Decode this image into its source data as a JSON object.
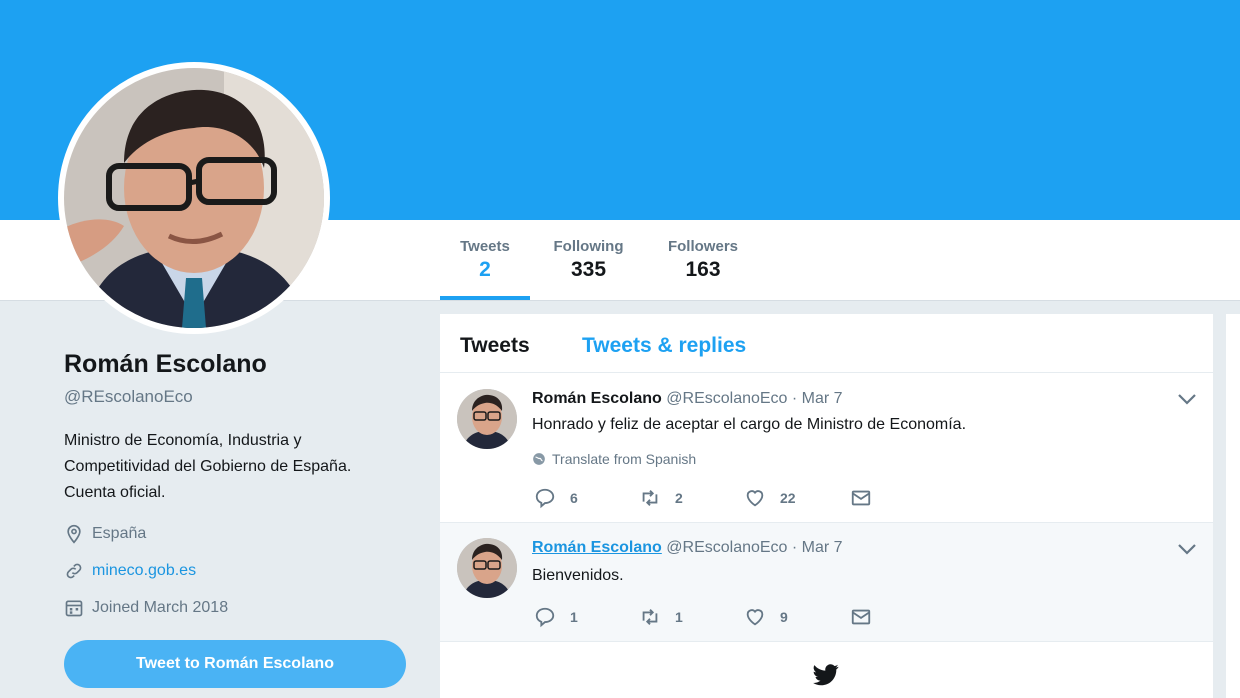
{
  "profile": {
    "name": "Román Escolano",
    "handle": "@REscolanoEco",
    "bio": "Ministro de Economía, Industria y Competitividad del Gobierno de España. Cuenta oficial.",
    "location": "España",
    "website": "mineco.gob.es",
    "joined": "Joined March 2018",
    "tweet_to_label": "Tweet to Román Escolano"
  },
  "stats": [
    {
      "label": "Tweets",
      "value": "2",
      "active": true
    },
    {
      "label": "Following",
      "value": "335",
      "active": false
    },
    {
      "label": "Followers",
      "value": "163",
      "active": false
    }
  ],
  "timeline_tabs": {
    "tweets": "Tweets",
    "tweets_replies": "Tweets & replies"
  },
  "tweets": [
    {
      "author": "Román Escolano",
      "handle": "@REscolanoEco",
      "date": "· Mar 7",
      "text": "Honrado y feliz de aceptar el cargo de Ministro de Economía.",
      "translate": "Translate from Spanish",
      "replies": "6",
      "retweets": "2",
      "likes": "22"
    },
    {
      "author": "Román Escolano",
      "handle": "@REscolanoEco",
      "date": "· Mar 7",
      "text": "Bienvenidos.",
      "replies": "1",
      "retweets": "1",
      "likes": "9"
    }
  ],
  "colors": {
    "brand": "#1da1f2",
    "button": "#4ab3f4",
    "muted": "#657786",
    "background": "#e6ecf0"
  },
  "icons": [
    "location-icon",
    "link-icon",
    "calendar-icon",
    "reply-icon",
    "retweet-icon",
    "like-icon",
    "dm-icon",
    "chevron-down-icon",
    "globe-icon",
    "twitter-bird-icon"
  ]
}
